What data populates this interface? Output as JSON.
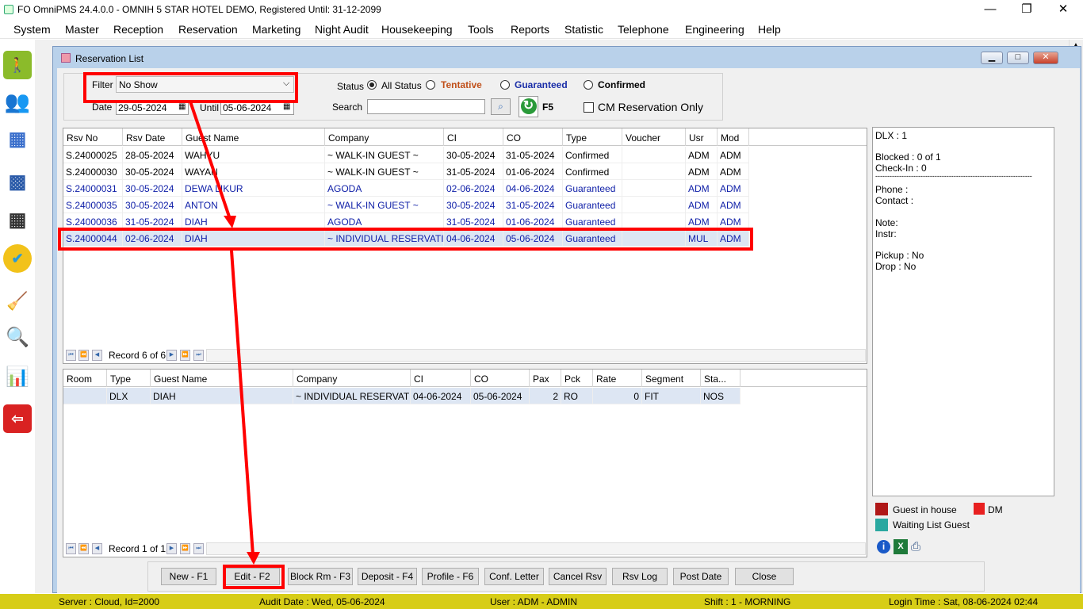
{
  "app": {
    "title": "FO OmniPMS 24.4.0.0 - OMNIH 5 STAR HOTEL DEMO, Registered Until: 31-12-2099",
    "min": "—",
    "restore": "❐",
    "close": "✕"
  },
  "menu": [
    "System",
    "Master",
    "Reception",
    "Reservation",
    "Marketing",
    "Night Audit",
    "Housekeeping",
    "Tools",
    "Reports",
    "Statistic",
    "Telephone",
    "Engineering",
    "Help"
  ],
  "window": {
    "title": "Reservation List"
  },
  "filter": {
    "filter_label": "Filter",
    "filter_value": "No Show",
    "date_label": "Date",
    "date_value": "29-05-2024",
    "until_label": "Until",
    "until_value": "05-06-2024",
    "status_label": "Status",
    "all_status": "All Status",
    "tentative": "Tentative",
    "guaranteed": "Guaranteed",
    "confirmed": "Confirmed",
    "search_label": "Search",
    "search_value": "",
    "refresh_key": "F5",
    "cm_only": "CM Reservation Only"
  },
  "colors": {
    "tentative": "#c0501a",
    "guaranteed": "#1a2ea8",
    "status_bar": "#d7cd17",
    "highlight": "#ff0000"
  },
  "reservations": {
    "headers": [
      "Rsv No",
      "Rsv Date",
      "Guest Name",
      "Company",
      "CI",
      "CO",
      "Type",
      "Voucher",
      "Usr",
      "Mod"
    ],
    "rows": [
      [
        "S.24000025",
        "28-05-2024",
        "WAHYU",
        "~ WALK-IN GUEST ~",
        "30-05-2024",
        "31-05-2024",
        "Confirmed",
        "",
        "ADM",
        "ADM"
      ],
      [
        "S.24000030",
        "30-05-2024",
        "WAYAN",
        "~ WALK-IN GUEST ~",
        "31-05-2024",
        "01-06-2024",
        "Confirmed",
        "",
        "ADM",
        "ADM"
      ],
      [
        "S.24000031",
        "30-05-2024",
        "DEWA LIKUR",
        "AGODA",
        "02-06-2024",
        "04-06-2024",
        "Guaranteed",
        "",
        "ADM",
        "ADM"
      ],
      [
        "S.24000035",
        "30-05-2024",
        "ANTON",
        "~ WALK-IN GUEST ~",
        "30-05-2024",
        "31-05-2024",
        "Guaranteed",
        "",
        "ADM",
        "ADM"
      ],
      [
        "S.24000036",
        "31-05-2024",
        "DIAH",
        "AGODA",
        "31-05-2024",
        "01-06-2024",
        "Guaranteed",
        "",
        "ADM",
        "ADM"
      ],
      [
        "S.24000044",
        "02-06-2024",
        "DIAH",
        "~ INDIVIDUAL RESERVATI...",
        "04-06-2024",
        "05-06-2024",
        "Guaranteed",
        "",
        "MUL",
        "ADM"
      ]
    ],
    "record_text": "Record 6 of 6"
  },
  "rooms": {
    "headers": [
      "Room",
      "Type",
      "Guest Name",
      "Company",
      "CI",
      "CO",
      "Pax",
      "Pck",
      "Rate",
      "Segment",
      "Sta..."
    ],
    "rows": [
      [
        "",
        "DLX",
        "DIAH",
        "~ INDIVIDUAL RESERVATI...",
        "04-06-2024",
        "05-06-2024",
        "2",
        "RO",
        "0",
        "FIT",
        "NOS"
      ]
    ],
    "record_text": "Record 1 of 1"
  },
  "info": {
    "room_type": "DLX : 1",
    "blocked": "Blocked : 0 of 1",
    "checkin": "Check-In : 0",
    "separator": "------------------------------------------------------------------",
    "phone": "Phone :",
    "contact": "Contact :",
    "note": "Note:",
    "instr": "Instr:",
    "pickup": "Pickup : No",
    "drop": "Drop : No"
  },
  "legend": {
    "guest_in_house": "Guest in house",
    "dm": "DM",
    "waiting": "Waiting List Guest"
  },
  "buttons": [
    "New - F1",
    "Edit - F2",
    "Block Rm - F3",
    "Deposit - F4",
    "Profile - F6",
    "Conf. Letter",
    "Cancel Rsv",
    "Rsv Log",
    "Post Date",
    "Close"
  ],
  "status": {
    "server": "Server : Cloud, Id=2000",
    "audit": "Audit Date : Wed, 05-06-2024",
    "user": "User : ADM - ADMIN",
    "shift": "Shift : 1 - MORNING",
    "login": "Login Time : Sat, 08-06-2024 02:44"
  }
}
